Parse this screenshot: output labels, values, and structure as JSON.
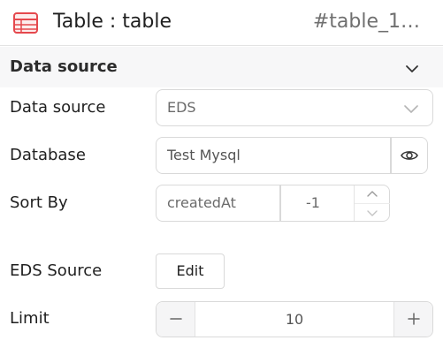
{
  "header": {
    "title": "Table : table",
    "component_id": "#table_1…",
    "icon": "table-icon",
    "accent_color": "#e5484d"
  },
  "section": {
    "title": "Data source",
    "expanded": true
  },
  "fields": {
    "data_source": {
      "label": "Data source",
      "value": "EDS"
    },
    "database": {
      "label": "Database",
      "value": "Test Mysql"
    },
    "sort_by": {
      "label": "Sort By",
      "field": "createdAt",
      "direction": "-1"
    },
    "eds_source": {
      "label": "EDS Source",
      "button_label": "Edit"
    },
    "limit": {
      "label": "Limit",
      "value": "10"
    }
  }
}
